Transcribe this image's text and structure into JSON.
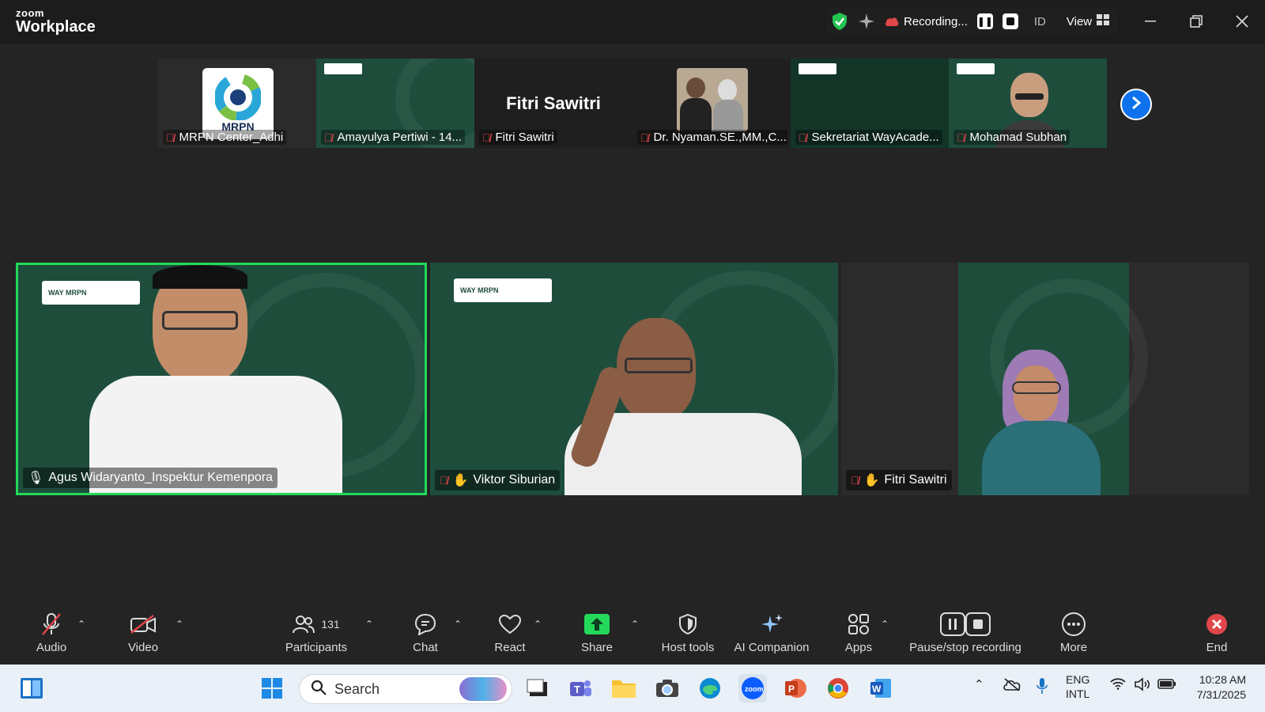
{
  "app": {
    "brand_small": "zoom",
    "brand_large": "Workplace"
  },
  "titlebar": {
    "recording_label": "Recording...",
    "language_label": "ID",
    "view_label": "View",
    "minimize_icon": "minimize-icon",
    "restore_icon": "restore-icon",
    "close_icon": "close-icon"
  },
  "thumbnails": [
    {
      "name": "MRPN Center_Adhi",
      "logo_text": "MRPN"
    },
    {
      "name": "Amayulya Pertiwi - 14..."
    },
    {
      "name": "Fitri Sawitri",
      "display_text": "Fitri Sawitri"
    },
    {
      "name": "Dr.  Nyaman.SE.,MM.,C..."
    },
    {
      "name": "Sekretariat WayAcade..."
    },
    {
      "name": "Mohamad Subhan"
    }
  ],
  "gallery": [
    {
      "name": "Agus Widaryanto_Inspektur Kemenpora",
      "badge": "WAY  MRPN",
      "active": true
    },
    {
      "name": "Viktor Siburian",
      "badge": "WAY  MRPN"
    },
    {
      "name": "Fitri Sawitri"
    }
  ],
  "toolbar": {
    "audio": "Audio",
    "video": "Video",
    "participants": "Participants",
    "participants_count": "131",
    "chat": "Chat",
    "react": "React",
    "share": "Share",
    "host_tools": "Host tools",
    "ai_companion": "AI Companion",
    "apps": "Apps",
    "pause_stop_recording": "Pause/stop recording",
    "more": "More",
    "end": "End"
  },
  "taskbar": {
    "search_placeholder": "Search",
    "lang_top": "ENG",
    "lang_bottom": "INTL",
    "time": "10:28 AM",
    "date": "7/31/2025"
  },
  "colors": {
    "accent_green": "#23d959",
    "tile_bg": "#1e4d3c",
    "blue": "#0e72ed",
    "mute_red": "#e0464a"
  }
}
